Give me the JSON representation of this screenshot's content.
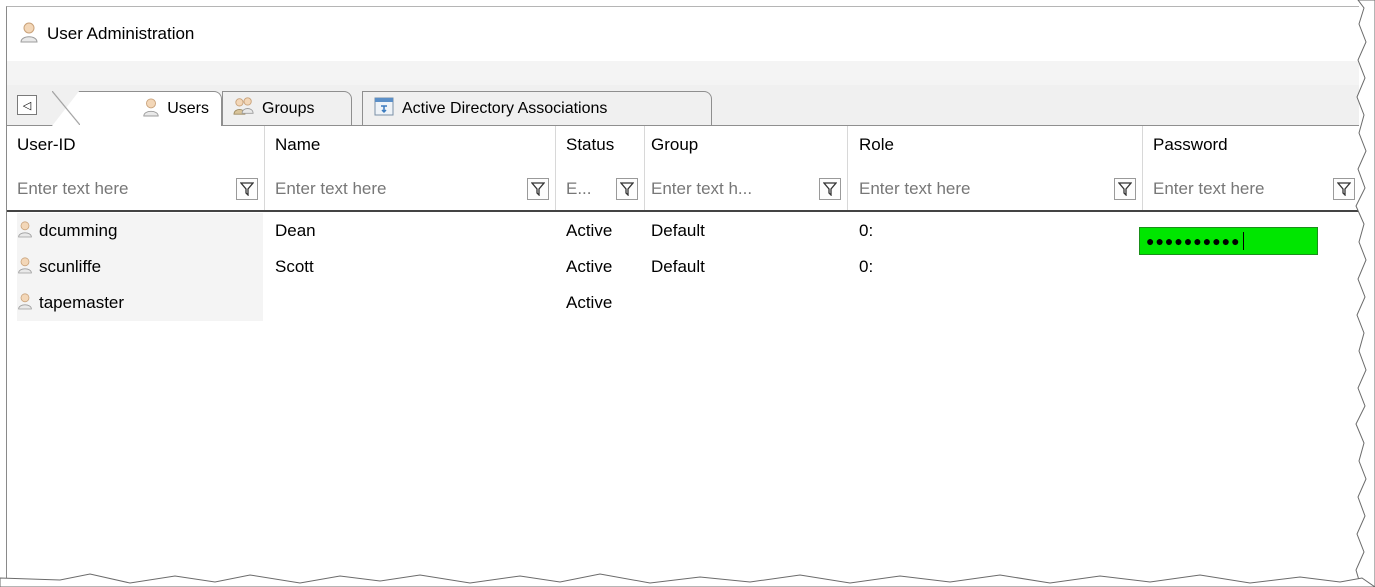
{
  "window": {
    "title": "User Administration",
    "icon": "user-icon"
  },
  "tabs": [
    {
      "label": "Users",
      "icon": "user-icon",
      "active": true
    },
    {
      "label": "Groups",
      "icon": "groups-icon",
      "active": false
    },
    {
      "label": "Active Directory Associations",
      "icon": "directory-icon",
      "active": false
    }
  ],
  "nav": {
    "prev_glyph": "◁"
  },
  "columns": [
    {
      "title": "User-ID",
      "placeholder": "Enter text here"
    },
    {
      "title": "Name",
      "placeholder": "Enter text here"
    },
    {
      "title": "Status",
      "placeholder": "E..."
    },
    {
      "title": "Group",
      "placeholder": "Enter text h..."
    },
    {
      "title": "Role",
      "placeholder": "Enter text here"
    },
    {
      "title": "Password",
      "placeholder": "Enter text here"
    }
  ],
  "rows": [
    {
      "user_id": "dcumming",
      "name": "Dean",
      "status": "Active",
      "group": "Default",
      "role": "0:"
    },
    {
      "user_id": "scunliffe",
      "name": "Scott",
      "status": "Active",
      "group": "Default",
      "role": "0:"
    },
    {
      "user_id": "tapemaster",
      "name": "",
      "status": "Active",
      "group": "",
      "role": ""
    }
  ],
  "password_edit": {
    "masked": "●●●●●●●●●●"
  },
  "colors": {
    "password_bg": "#00e600",
    "tab_bg": "#f0f0f0"
  }
}
